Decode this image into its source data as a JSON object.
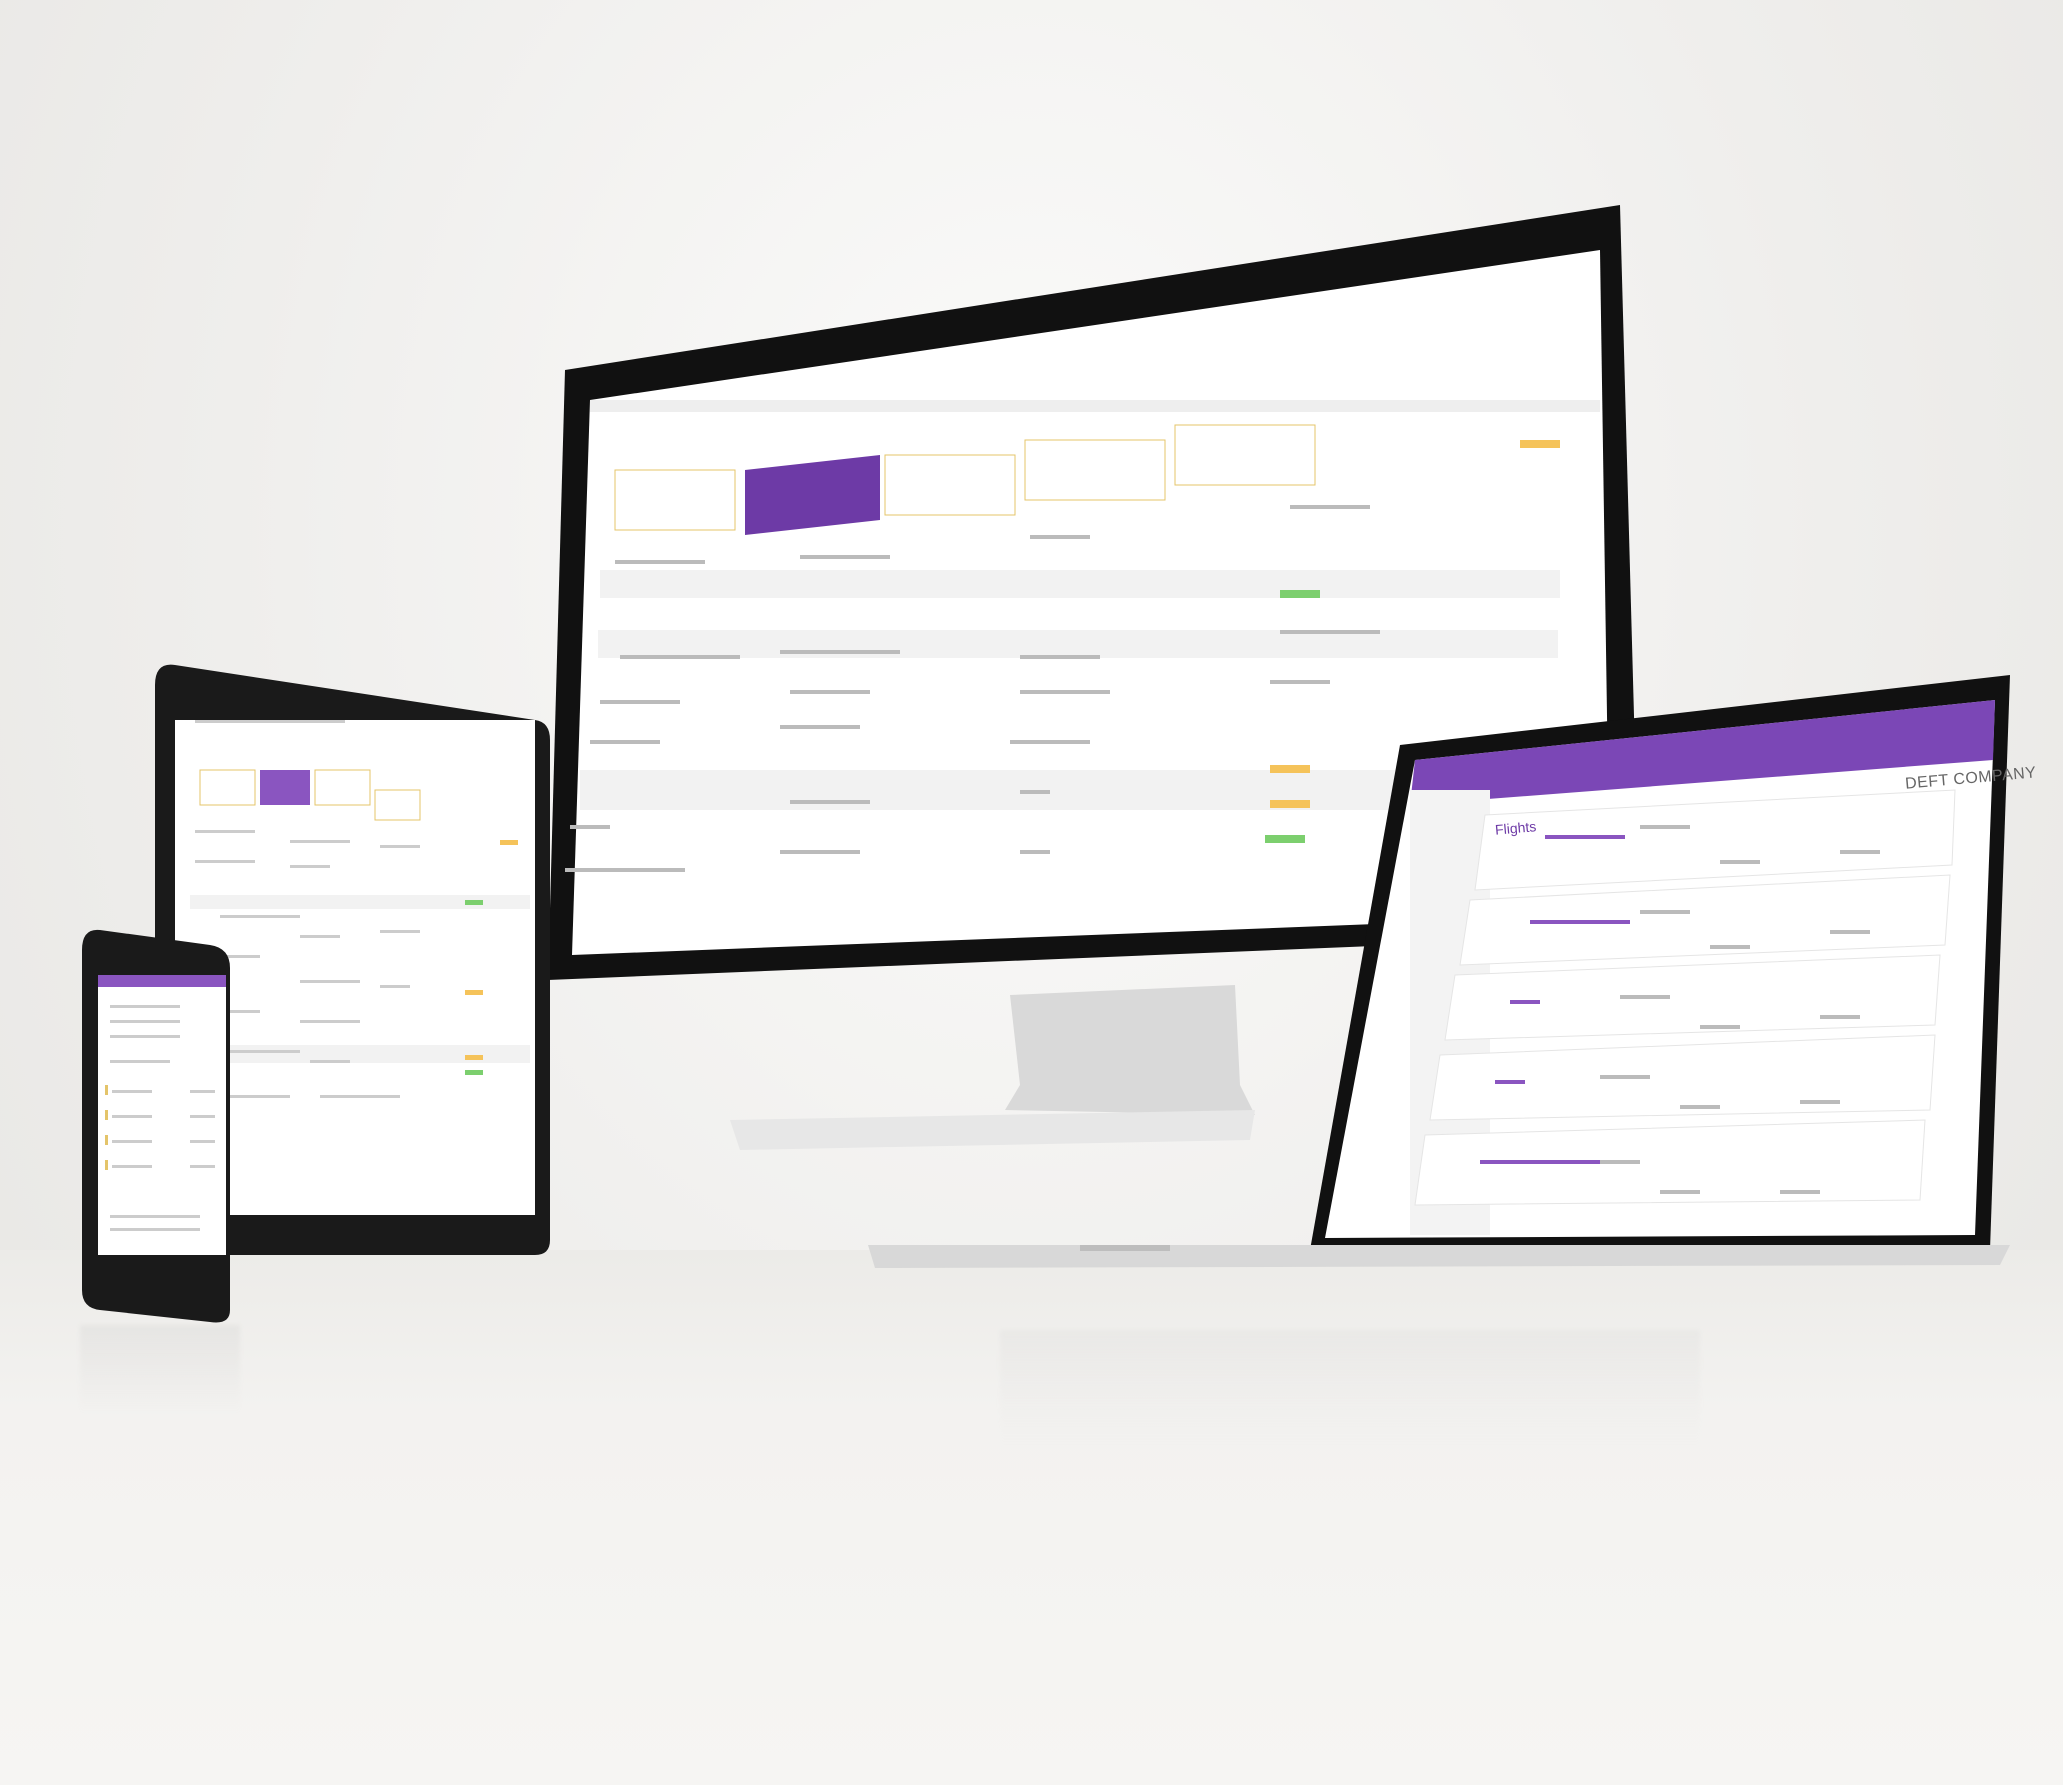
{
  "laptop": {
    "company_label": "DEFT COMPANY",
    "page_title": "Flights"
  },
  "colors": {
    "accent": "#6d3aa6",
    "warning_badge": "#f5c35a",
    "success_badge": "#7ccf6e"
  },
  "icons": [
    "monitor-icon",
    "laptop-icon",
    "tablet-icon",
    "phone-icon"
  ]
}
